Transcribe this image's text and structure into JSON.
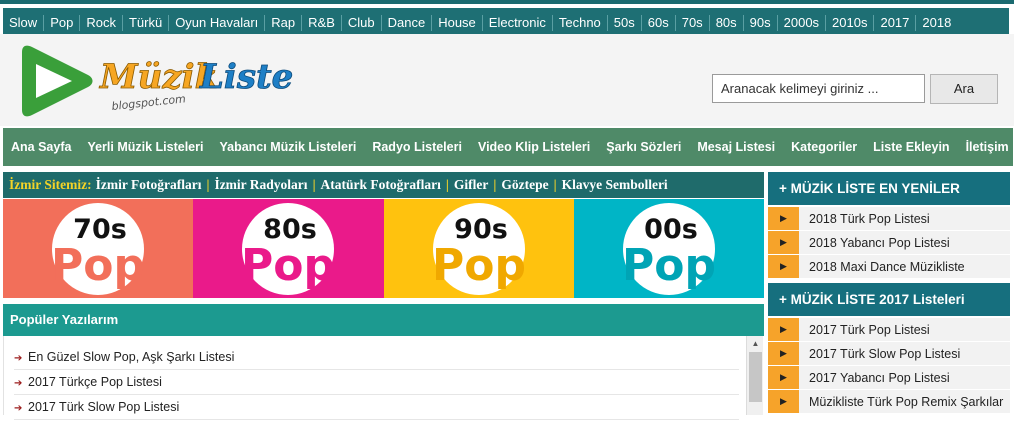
{
  "genres": [
    "Slow",
    "Pop",
    "Rock",
    "Türkü",
    "Oyun Havaları",
    "Rap",
    "R&B",
    "Club",
    "Dance",
    "House",
    "Electronic",
    "Techno",
    "50s",
    "60s",
    "70s",
    "80s",
    "90s",
    "2000s",
    "2010s",
    "2017",
    "2018"
  ],
  "logo": {
    "word1": "Müzik",
    "word2": "Liste",
    "sub": "blogspot.com"
  },
  "search": {
    "placeholder": "Aranacak kelimeyi giriniz ...",
    "button": "Ara"
  },
  "nav": [
    "Ana Sayfa",
    "Yerli Müzik Listeleri",
    "Yabancı Müzik Listeleri",
    "Radyo Listeleri",
    "Video Klip Listeleri",
    "Şarkı Sözleri",
    "Mesaj Listesi",
    "Kategoriler",
    "Liste Ekleyin",
    "İletişim"
  ],
  "izmir": {
    "label": "İzmir Sitemiz:",
    "links": [
      "İzmir Fotoğrafları",
      "İzmir Radyoları",
      "Atatürk Fotoğrafları",
      "Gifler",
      "Göztepe",
      "Klavye Sembolleri"
    ]
  },
  "tiles": [
    {
      "top": "70s",
      "bottom": "Pop",
      "bg": "#f26f5a",
      "fg": "#f26f5a"
    },
    {
      "top": "80s",
      "bottom": "Pop",
      "bg": "#ea1a8a",
      "fg": "#ea1a8a"
    },
    {
      "top": "90s",
      "bottom": "Pop",
      "bg": "#ffc20e",
      "fg": "#f0a800"
    },
    {
      "top": "00s",
      "bottom": "Pop",
      "bg": "#00b5c6",
      "fg": "#00a4b5"
    }
  ],
  "popular": {
    "title": "Popüler Yazılarım",
    "items": [
      "En Güzel Slow Pop, Aşk Şarkı Listesi",
      "2017 Türkçe Pop Listesi",
      "2017 Türk Slow Pop Listesi"
    ]
  },
  "sidebar": {
    "section1": {
      "title": "+ MÜZİK LİSTE EN YENİLER",
      "items": [
        "2018 Türk Pop Listesi",
        "2018 Yabancı Pop Listesi",
        "2018 Maxi Dance Müzikliste"
      ]
    },
    "section2": {
      "title": "+ MÜZİK LİSTE 2017 Listeleri",
      "items": [
        "2017 Türk Pop Listesi",
        "2017 Türk Slow Pop Listesi",
        "2017 Yabancı Pop Listesi",
        "Müzikliste Türk Pop Remix Şarkılar"
      ]
    }
  },
  "colors": {
    "teal_bar": "#1e6f74",
    "nav_green": "#4f8a68",
    "popular_head": "#1c9a90",
    "side_head": "#166f7e",
    "side_bullet": "#f6a32a",
    "izmir_label": "#f5d327"
  }
}
